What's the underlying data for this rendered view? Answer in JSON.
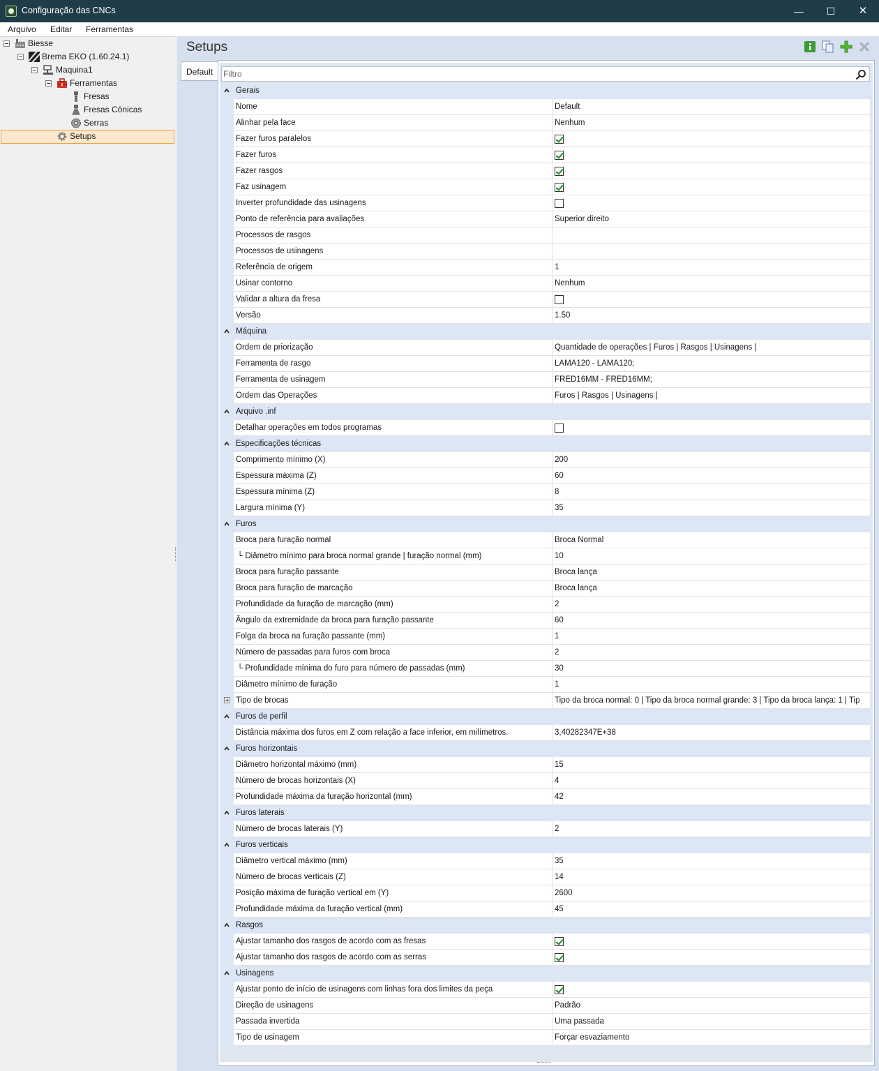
{
  "window": {
    "title": "Configuração das CNCs",
    "minimize": "—",
    "maximize": "☐",
    "close": "✕"
  },
  "menu": [
    "Arquivo",
    "Editar",
    "Ferramentas"
  ],
  "tree": {
    "root": "Biesse",
    "brand": "Brema EKO (1.60.24.1)",
    "machine": "Maquina1",
    "tools": "Ferramentas",
    "mills": "Fresas",
    "conical": "Fresas Cônicas",
    "saws": "Serras",
    "setups": "Setups"
  },
  "header": {
    "title": "Setups"
  },
  "tab": "Default",
  "filter": {
    "placeholder": "Filtro"
  },
  "categories": [
    {
      "name": "Gerais",
      "props": [
        {
          "name": "Nome",
          "value": "Default"
        },
        {
          "name": "Alinhar pela face",
          "value": "Nenhum"
        },
        {
          "name": "Fazer furos paralelos",
          "checked": true
        },
        {
          "name": "Fazer furos",
          "checked": true
        },
        {
          "name": "Fazer rasgos",
          "checked": true
        },
        {
          "name": "Faz usinagem",
          "checked": true
        },
        {
          "name": "Inverter profundidade das usinagens",
          "checked": false
        },
        {
          "name": "Ponto de referência para avaliações",
          "value": "Superior direito"
        },
        {
          "name": "Processos de rasgos",
          "value": ""
        },
        {
          "name": "Processos de usinagens",
          "value": ""
        },
        {
          "name": "Referência de origem",
          "value": "1"
        },
        {
          "name": "Usinar contorno",
          "value": "Nenhum"
        },
        {
          "name": "Validar a altura da fresa",
          "checked": false
        },
        {
          "name": "Versão",
          "value": "1.50"
        }
      ]
    },
    {
      "name": "Máquina",
      "props": [
        {
          "name": "Ordem de priorização",
          "value": "Quantidade de operações | Furos | Rasgos | Usinagens |"
        },
        {
          "name": "Ferramenta de rasgo",
          "value": "LAMA120 - LAMA120;"
        },
        {
          "name": "Ferramenta de usinagem",
          "value": "FRED16MM - FRED16MM;"
        },
        {
          "name": "Ordem das Operações",
          "value": "Furos | Rasgos | Usinagens |"
        }
      ]
    },
    {
      "name": "Arquivo .inf",
      "props": [
        {
          "name": "Detalhar operações em todos programas",
          "checked": false
        }
      ]
    },
    {
      "name": "Especificações técnicas",
      "props": [
        {
          "name": "Comprimento mínimo (X)",
          "value": "200"
        },
        {
          "name": "Espessura máxima (Z)",
          "value": "60"
        },
        {
          "name": "Espessura mínima (Z)",
          "value": "8"
        },
        {
          "name": "Largura mínima (Y)",
          "value": "35"
        }
      ]
    },
    {
      "name": "Furos",
      "props": [
        {
          "name": "Broca para furação normal",
          "value": "Broca Normal"
        },
        {
          "name": "└ Diâmetro mínimo para broca normal grande | furação normal (mm)",
          "value": "10",
          "sub": true
        },
        {
          "name": "Broca para furação passante",
          "value": "Broca lança"
        },
        {
          "name": "Broca para furação de marcação",
          "value": "Broca lança"
        },
        {
          "name": "Profundidade da furação de marcação (mm)",
          "value": "2"
        },
        {
          "name": "Ângulo da extremidade da broca para furação passante",
          "value": "60"
        },
        {
          "name": "Folga da broca na furação passante (mm)",
          "value": "1"
        },
        {
          "name": "Número de passadas para furos com broca",
          "value": "2"
        },
        {
          "name": "└ Profundidade mínima do furo para número de passadas (mm)",
          "value": "30",
          "sub": true
        },
        {
          "name": "Diâmetro mínimo de furação",
          "value": "1"
        },
        {
          "name": "Tipo de brocas",
          "value": "Tipo da broca normal: 0  |  Tipo da broca normal grande: 3  |  Tipo da broca lança: 1  |  Tip",
          "expand": true
        }
      ]
    },
    {
      "name": "Furos de perfil",
      "props": [
        {
          "name": "Distância máxima dos furos em Z com relação a face inferior, em milímetros.",
          "value": "3,40282347E+38"
        }
      ]
    },
    {
      "name": "Furos horizontais",
      "props": [
        {
          "name": "Diâmetro horizontal máximo (mm)",
          "value": "15"
        },
        {
          "name": "Número de brocas horizontais (X)",
          "value": "4"
        },
        {
          "name": "Profundidade máxima da furação horizontal (mm)",
          "value": "42"
        }
      ]
    },
    {
      "name": "Furos laterais",
      "props": [
        {
          "name": "Número de brocas laterais (Y)",
          "value": "2"
        }
      ]
    },
    {
      "name": "Furos verticais",
      "props": [
        {
          "name": "Diâmetro vertical máximo (mm)",
          "value": "35"
        },
        {
          "name": "Número de brocas verticais (Z)",
          "value": "14"
        },
        {
          "name": "Posição máxima de furação vertical em (Y)",
          "value": "2600"
        },
        {
          "name": "Profundidade máxima da furação vertical (mm)",
          "value": "45"
        }
      ]
    },
    {
      "name": "Rasgos",
      "props": [
        {
          "name": "Ajustar tamanho dos rasgos de acordo com as fresas",
          "checked": true
        },
        {
          "name": "Ajustar tamanho dos rasgos de acordo com as serras",
          "checked": true
        }
      ]
    },
    {
      "name": "Usinagens",
      "props": [
        {
          "name": "Ajustar ponto de início de usinagens com linhas fora dos limites da peça",
          "checked": true
        },
        {
          "name": "Direção de usinagens",
          "value": "Padrão"
        },
        {
          "name": "Passada invertida",
          "value": "Uma passada"
        },
        {
          "name": "Tipo de usinagem",
          "value": "Forçar esvaziamento"
        }
      ]
    }
  ]
}
